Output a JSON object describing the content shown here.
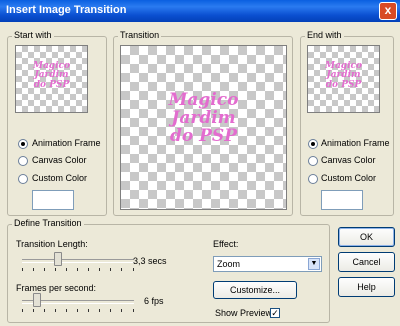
{
  "window": {
    "title": "Insert Image Transition",
    "close_glyph": "x"
  },
  "start_with": {
    "label": "Start with",
    "preview_text": [
      "Magico",
      "Jardim",
      "do PSP"
    ],
    "options": [
      "Animation Frame",
      "Canvas Color",
      "Custom Color"
    ],
    "selected": "Animation Frame"
  },
  "transition": {
    "label": "Transition",
    "preview_text": [
      "Magico",
      "Jardim",
      "do PSP"
    ]
  },
  "end_with": {
    "label": "End with",
    "preview_text": [
      "Magico",
      "Jardim",
      "do PSP"
    ],
    "options": [
      "Animation Frame",
      "Canvas Color",
      "Custom Color"
    ],
    "selected": "Animation Frame"
  },
  "define": {
    "label": "Define Transition",
    "length_label": "Transition Length:",
    "length_value": "3,3 secs",
    "fps_label": "Frames per second:",
    "fps_value": "6 fps",
    "effect_label": "Effect:",
    "effect_value": "Zoom",
    "customize_label": "Customize...",
    "show_preview_label": "Show Preview",
    "show_preview_checked": true
  },
  "buttons": {
    "ok": "OK",
    "cancel": "Cancel",
    "help": "Help"
  }
}
